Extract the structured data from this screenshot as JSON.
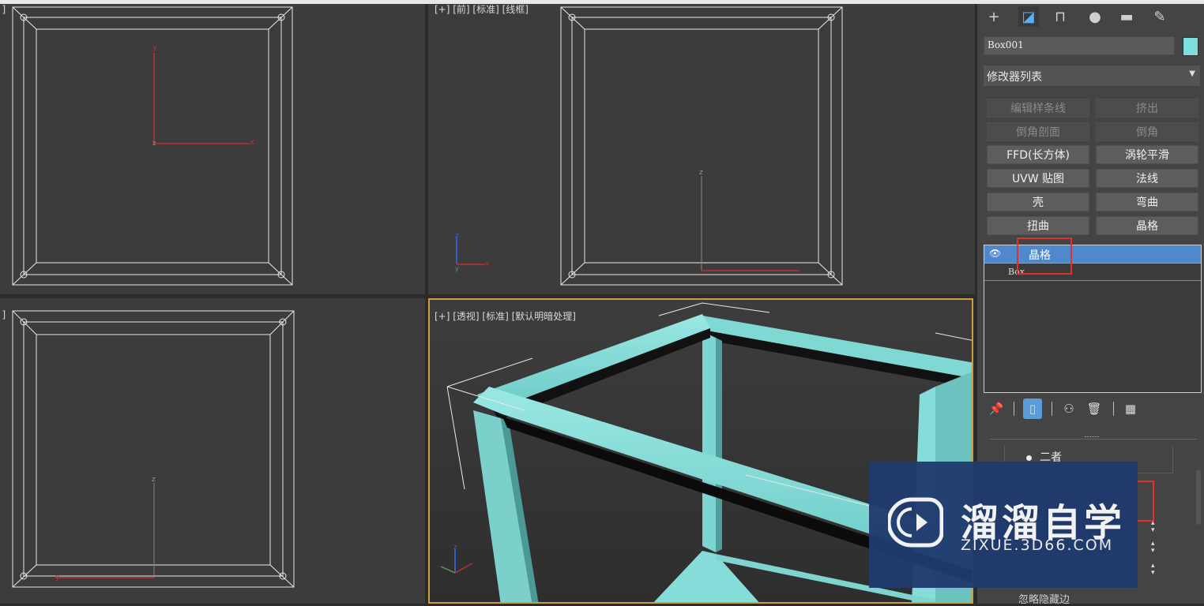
{
  "viewports": {
    "top_left_label": "[ ]",
    "front_label": "[+] [前] [标准] [线框]",
    "bottom_left_label": "[ ]",
    "perspective_label": "[+] [透视] [标准] [默认明暗处理]"
  },
  "command_panel": {
    "tabs": [
      "create-icon",
      "modify-icon",
      "hierarchy-icon",
      "motion-icon",
      "display-icon",
      "utilities-icon"
    ],
    "object_name": "Box001",
    "object_color": "#7ee0dc",
    "modifier_list_label": "修改器列表",
    "modifier_buttons": [
      {
        "label": "编辑样条线",
        "enabled": false
      },
      {
        "label": "挤出",
        "enabled": false
      },
      {
        "label": "倒角剖面",
        "enabled": false
      },
      {
        "label": "倒角",
        "enabled": false
      },
      {
        "label": "FFD(长方体)",
        "enabled": true
      },
      {
        "label": "涡轮平滑",
        "enabled": true
      },
      {
        "label": "UVW 贴图",
        "enabled": true
      },
      {
        "label": "法线",
        "enabled": true
      },
      {
        "label": "壳",
        "enabled": true
      },
      {
        "label": "弯曲",
        "enabled": true
      },
      {
        "label": "扭曲",
        "enabled": true
      },
      {
        "label": "晶格",
        "enabled": true
      }
    ],
    "stack": {
      "selected": "晶格",
      "base": "Box"
    },
    "radio_label": "二者",
    "bottom_text": "忽略隐藏边"
  },
  "watermark": {
    "title": "溜溜自学",
    "url": "ZIXUE.3D66.COM"
  },
  "colors": {
    "lattice": "#86dcd8",
    "selection": "#4f88cc",
    "highlight": "#e03030"
  }
}
